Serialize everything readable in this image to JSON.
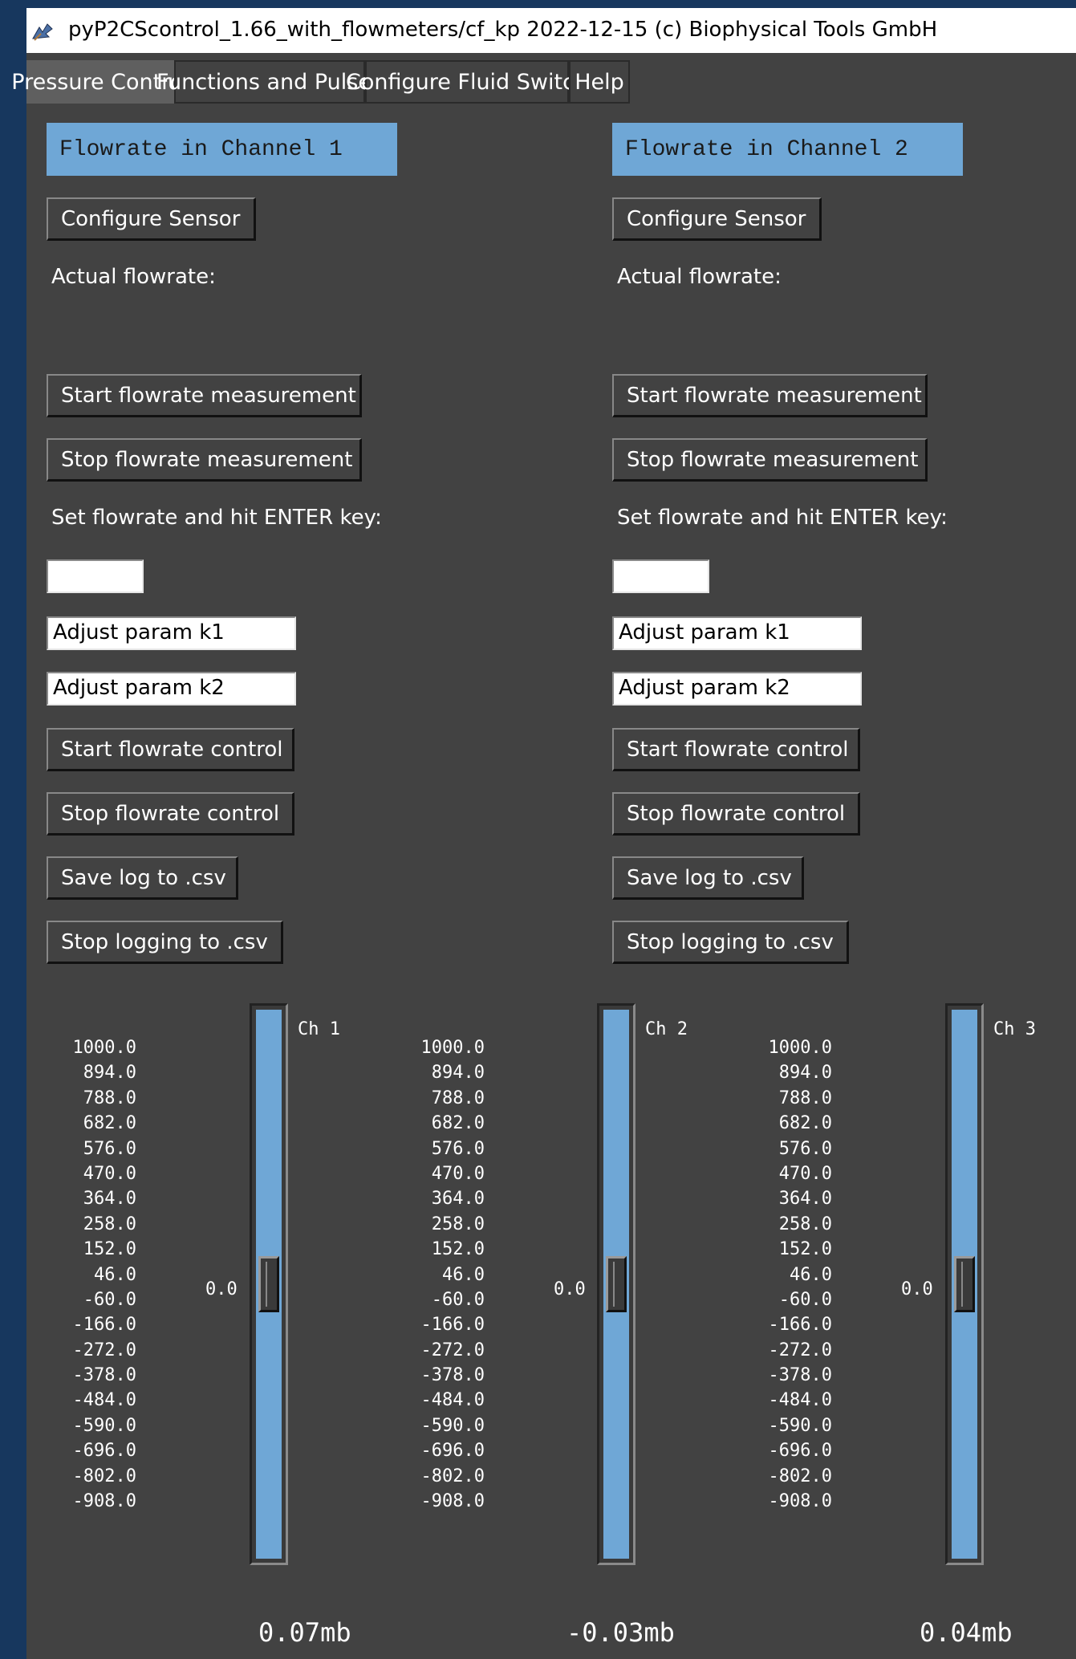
{
  "window": {
    "title": "pyP2CScontrol_1.66_with_flowmeters/cf_kp 2022-12-15  (c) Biophysical Tools GmbH",
    "icon": "feather-app-icon"
  },
  "tabs": [
    {
      "label": "Pressure Control",
      "active": true
    },
    {
      "label": "Functions and Pulses",
      "active": false
    },
    {
      "label": "Configure Fluid Switch",
      "active": false
    },
    {
      "label": "Help",
      "active": false
    }
  ],
  "channels": [
    {
      "header": "Flowrate in Channel 1",
      "configure_sensor": "Configure Sensor",
      "actual_flowrate_label": "Actual flowrate:",
      "start_measurement": "Start flowrate measurement",
      "stop_measurement": "Stop flowrate measurement",
      "set_flowrate_label": "Set flowrate and hit ENTER key:",
      "flowrate_value": "",
      "k1_value": "Adjust param k1",
      "k2_value": "Adjust param k2",
      "start_control": "Start flowrate control",
      "stop_control": "Stop flowrate control",
      "save_log": "Save log to .csv",
      "stop_logging": "Stop logging to .csv"
    },
    {
      "header": "Flowrate in Channel 2",
      "configure_sensor": "Configure Sensor",
      "actual_flowrate_label": "Actual flowrate:",
      "start_measurement": "Start flowrate measurement",
      "stop_measurement": "Stop flowrate measurement",
      "set_flowrate_label": "Set flowrate and hit ENTER key:",
      "flowrate_value": "",
      "k1_value": "Adjust param k1",
      "k2_value": "Adjust param k2",
      "start_control": "Start flowrate control",
      "stop_control": "Stop flowrate control",
      "save_log": "Save log to .csv",
      "stop_logging": "Stop logging to .csv"
    }
  ],
  "scale_ticks": [
    "1000.0",
    "894.0",
    "788.0",
    "682.0",
    "576.0",
    "470.0",
    "364.0",
    "258.0",
    "152.0",
    "46.0",
    "-60.0",
    "-166.0",
    "-272.0",
    "-378.0",
    "-484.0",
    "-590.0",
    "-696.0",
    "-802.0",
    "-908.0"
  ],
  "sliders": [
    {
      "name": "Ch 1",
      "value_label": "0.0",
      "readout": "0.07mb",
      "value": 0.0
    },
    {
      "name": "Ch 2",
      "value_label": "0.0",
      "readout": "-0.03mb",
      "value": 0.0
    },
    {
      "name": "Ch 3",
      "value_label": "0.0",
      "readout": "0.04mb",
      "value": 0.0
    }
  ]
}
